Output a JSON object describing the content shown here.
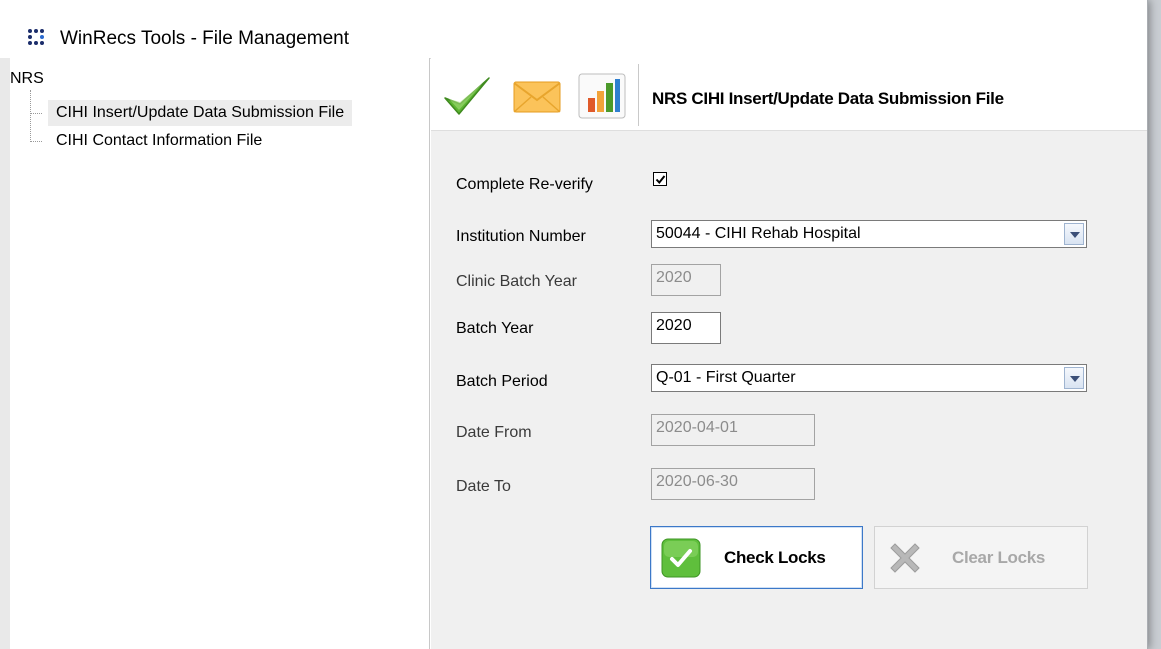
{
  "window": {
    "title": "WinRecs Tools - File Management"
  },
  "tree": {
    "root": "NRS",
    "items": [
      {
        "label": "CIHI Insert/Update Data Submission File",
        "selected": true
      },
      {
        "label": "CIHI Contact Information File",
        "selected": false
      }
    ]
  },
  "toolbar": {
    "icons": [
      "checkmark-icon",
      "envelope-icon",
      "bar-chart-icon"
    ],
    "title": "NRS CIHI Insert/Update Data Submission File"
  },
  "form": {
    "complete_reverify": {
      "label": "Complete Re-verify",
      "checked": true
    },
    "institution_number": {
      "label": "Institution Number",
      "value": "50044 - CIHI Rehab Hospital"
    },
    "clinic_batch_year": {
      "label": "Clinic Batch Year",
      "value": "2020"
    },
    "batch_year": {
      "label": "Batch Year",
      "value": "2020"
    },
    "batch_period": {
      "label": "Batch Period",
      "value": "Q-01 - First Quarter"
    },
    "date_from": {
      "label": "Date From",
      "value": "2020-04-01"
    },
    "date_to": {
      "label": "Date To",
      "value": "2020-06-30"
    }
  },
  "actions": {
    "check_locks": "Check Locks",
    "clear_locks": "Clear Locks"
  },
  "colors": {
    "accent_green": "#6cc04a",
    "focus_blue": "#3c78c8",
    "disabled_text": "#a8a8a8"
  }
}
